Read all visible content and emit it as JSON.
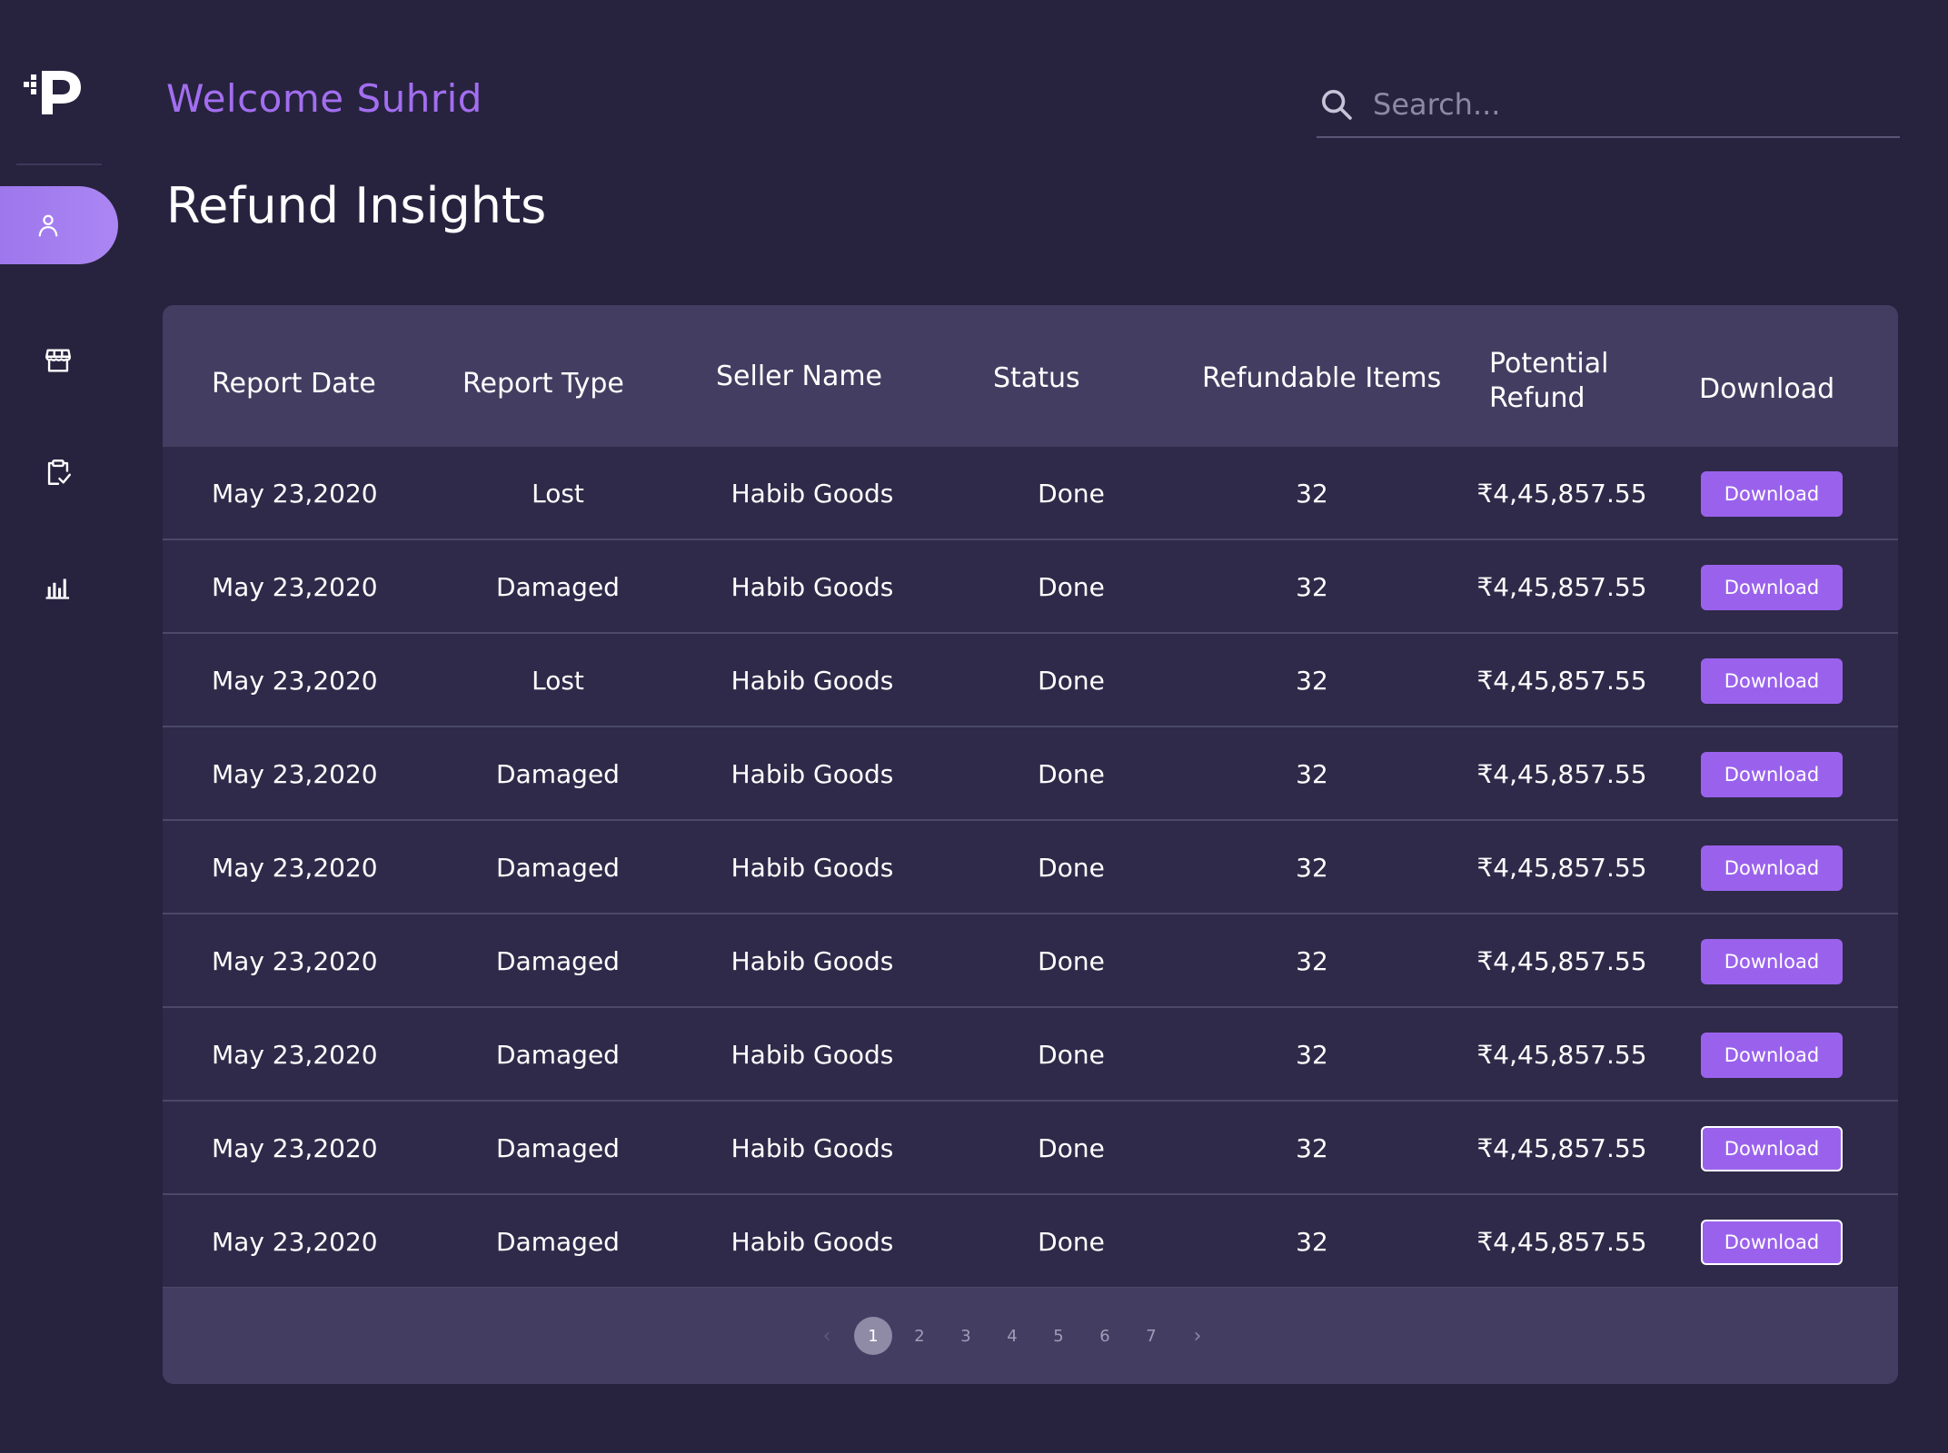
{
  "header": {
    "welcome": "Welcome Suhrid",
    "title": "Refund Insights"
  },
  "search": {
    "placeholder": "Search..."
  },
  "sidebar": {
    "logo": "P",
    "items": [
      {
        "icon": "user-icon",
        "active": true
      },
      {
        "icon": "store-icon",
        "active": false
      },
      {
        "icon": "clipboard-check-icon",
        "active": false
      },
      {
        "icon": "bar-chart-icon",
        "active": false
      }
    ]
  },
  "table": {
    "headers": {
      "report_date": "Report Date",
      "report_type": "Report Type",
      "seller_name": "Seller Name",
      "status": "Status",
      "refundable_items": "Refundable Items",
      "potential_refund_line1": "Potential",
      "potential_refund_line2": "Refund",
      "download": "Download"
    },
    "rows": [
      {
        "date": "May 23,2020",
        "type": "Lost",
        "seller": "Habib Goods",
        "status": "Done",
        "items": "32",
        "refund": "₹4,45,857.55",
        "button": "Download"
      },
      {
        "date": "May 23,2020",
        "type": "Damaged",
        "seller": "Habib Goods",
        "status": "Done",
        "items": "32",
        "refund": "₹4,45,857.55",
        "button": "Download"
      },
      {
        "date": "May 23,2020",
        "type": "Lost",
        "seller": "Habib Goods",
        "status": "Done",
        "items": "32",
        "refund": "₹4,45,857.55",
        "button": "Download"
      },
      {
        "date": "May 23,2020",
        "type": "Damaged",
        "seller": "Habib Goods",
        "status": "Done",
        "items": "32",
        "refund": "₹4,45,857.55",
        "button": "Download"
      },
      {
        "date": "May 23,2020",
        "type": "Damaged",
        "seller": "Habib Goods",
        "status": "Done",
        "items": "32",
        "refund": "₹4,45,857.55",
        "button": "Download"
      },
      {
        "date": "May 23,2020",
        "type": "Damaged",
        "seller": "Habib Goods",
        "status": "Done",
        "items": "32",
        "refund": "₹4,45,857.55",
        "button": "Download"
      },
      {
        "date": "May 23,2020",
        "type": "Damaged",
        "seller": "Habib Goods",
        "status": "Done",
        "items": "32",
        "refund": "₹4,45,857.55",
        "button": "Download"
      },
      {
        "date": "May 23,2020",
        "type": "Damaged",
        "seller": "Habib Goods",
        "status": "Done",
        "items": "32",
        "refund": "₹4,45,857.55",
        "button": "Download"
      },
      {
        "date": "May 23,2020",
        "type": "Damaged",
        "seller": "Habib Goods",
        "status": "Done",
        "items": "32",
        "refund": "₹4,45,857.55",
        "button": "Download"
      }
    ]
  },
  "pagination": {
    "prev": "‹",
    "next": "›",
    "pages": [
      "1",
      "2",
      "3",
      "4",
      "5",
      "6",
      "7"
    ],
    "current": "1"
  },
  "colors": {
    "background": "#27233f",
    "accent": "#a36ef0",
    "button": "#9a62ec",
    "table_header": "#433e61",
    "table_body": "#2f2a49"
  }
}
